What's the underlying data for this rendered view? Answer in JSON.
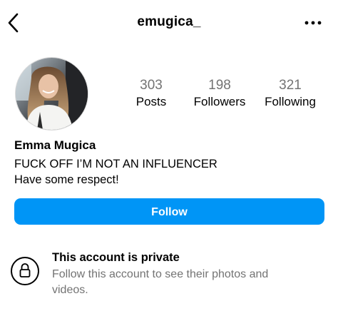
{
  "header": {
    "username": "emugica_",
    "back_icon": "chevron-left-icon",
    "more_icon": "more-horizontal-icon"
  },
  "profile": {
    "avatar_icon": "profile-photo",
    "full_name": "Emma Mugica",
    "bio_line1": "FUCK OFF I’M NOT AN INFLUENCER",
    "bio_line2": "Have some respect!"
  },
  "stats": {
    "posts_count": "303",
    "posts_label": "Posts",
    "followers_count": "198",
    "followers_label": "Followers",
    "following_count": "321",
    "following_label": "Following"
  },
  "actions": {
    "follow_label": "Follow"
  },
  "private_notice": {
    "icon": "lock-icon",
    "title": "This account is private",
    "description": "Follow this account to see their photos and videos."
  },
  "colors": {
    "accent": "#0095f6",
    "secondary_text": "#737373"
  }
}
